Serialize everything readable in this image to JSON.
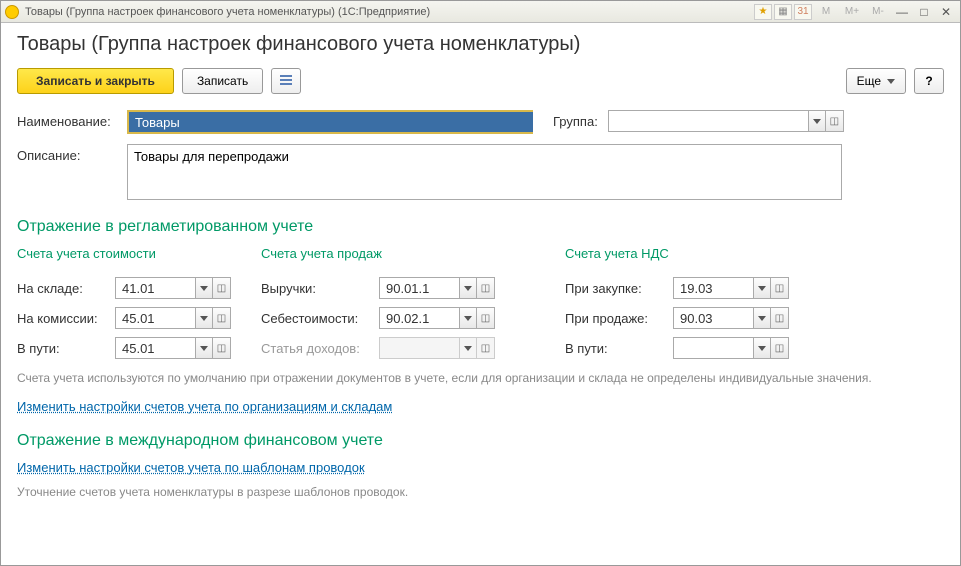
{
  "titlebar": {
    "title": "Товары (Группа настроек финансового учета номенклатуры)  (1С:Предприятие)"
  },
  "page": {
    "title": "Товары (Группа настроек финансового учета номенклатуры)"
  },
  "toolbar": {
    "save_close": "Записать и закрыть",
    "save": "Записать",
    "more": "Еще",
    "help": "?"
  },
  "form": {
    "name_label": "Наименование:",
    "name_value": "Товары",
    "group_label": "Группа:",
    "group_value": "",
    "description_label": "Описание:",
    "description_value": "Товары для перепродажи"
  },
  "sections": {
    "regulated": {
      "title": "Отражение в регламетированном учете",
      "cost": {
        "title": "Счета учета стоимости",
        "in_stock_label": "На складе:",
        "in_stock_value": "41.01",
        "on_commission_label": "На комиссии:",
        "on_commission_value": "45.01",
        "in_transit_label": "В пути:",
        "in_transit_value": "45.01"
      },
      "sales": {
        "title": "Счета учета продаж",
        "revenue_label": "Выручки:",
        "revenue_value": "90.01.1",
        "cost_label": "Себестоимости:",
        "cost_value": "90.02.1",
        "income_item_label": "Статья доходов:",
        "income_item_value": ""
      },
      "vat": {
        "title": "Счета учета НДС",
        "purchase_label": "При закупке:",
        "purchase_value": "19.03",
        "sale_label": "При продаже:",
        "sale_value": "90.03",
        "in_transit_label": "В пути:",
        "in_transit_value": ""
      },
      "hint": "Счета учета используются по умолчанию при отражении документов в учете, если для организации и склада не определены индивидуальные значения.",
      "link": "Изменить настройки счетов учета по организациям и складам"
    },
    "ifrs": {
      "title": "Отражение в международном финансовом учете",
      "link": "Изменить настройки счетов учета по шаблонам проводок",
      "footnote": "Уточнение счетов учета номенклатуры в разрезе шаблонов проводок."
    }
  }
}
